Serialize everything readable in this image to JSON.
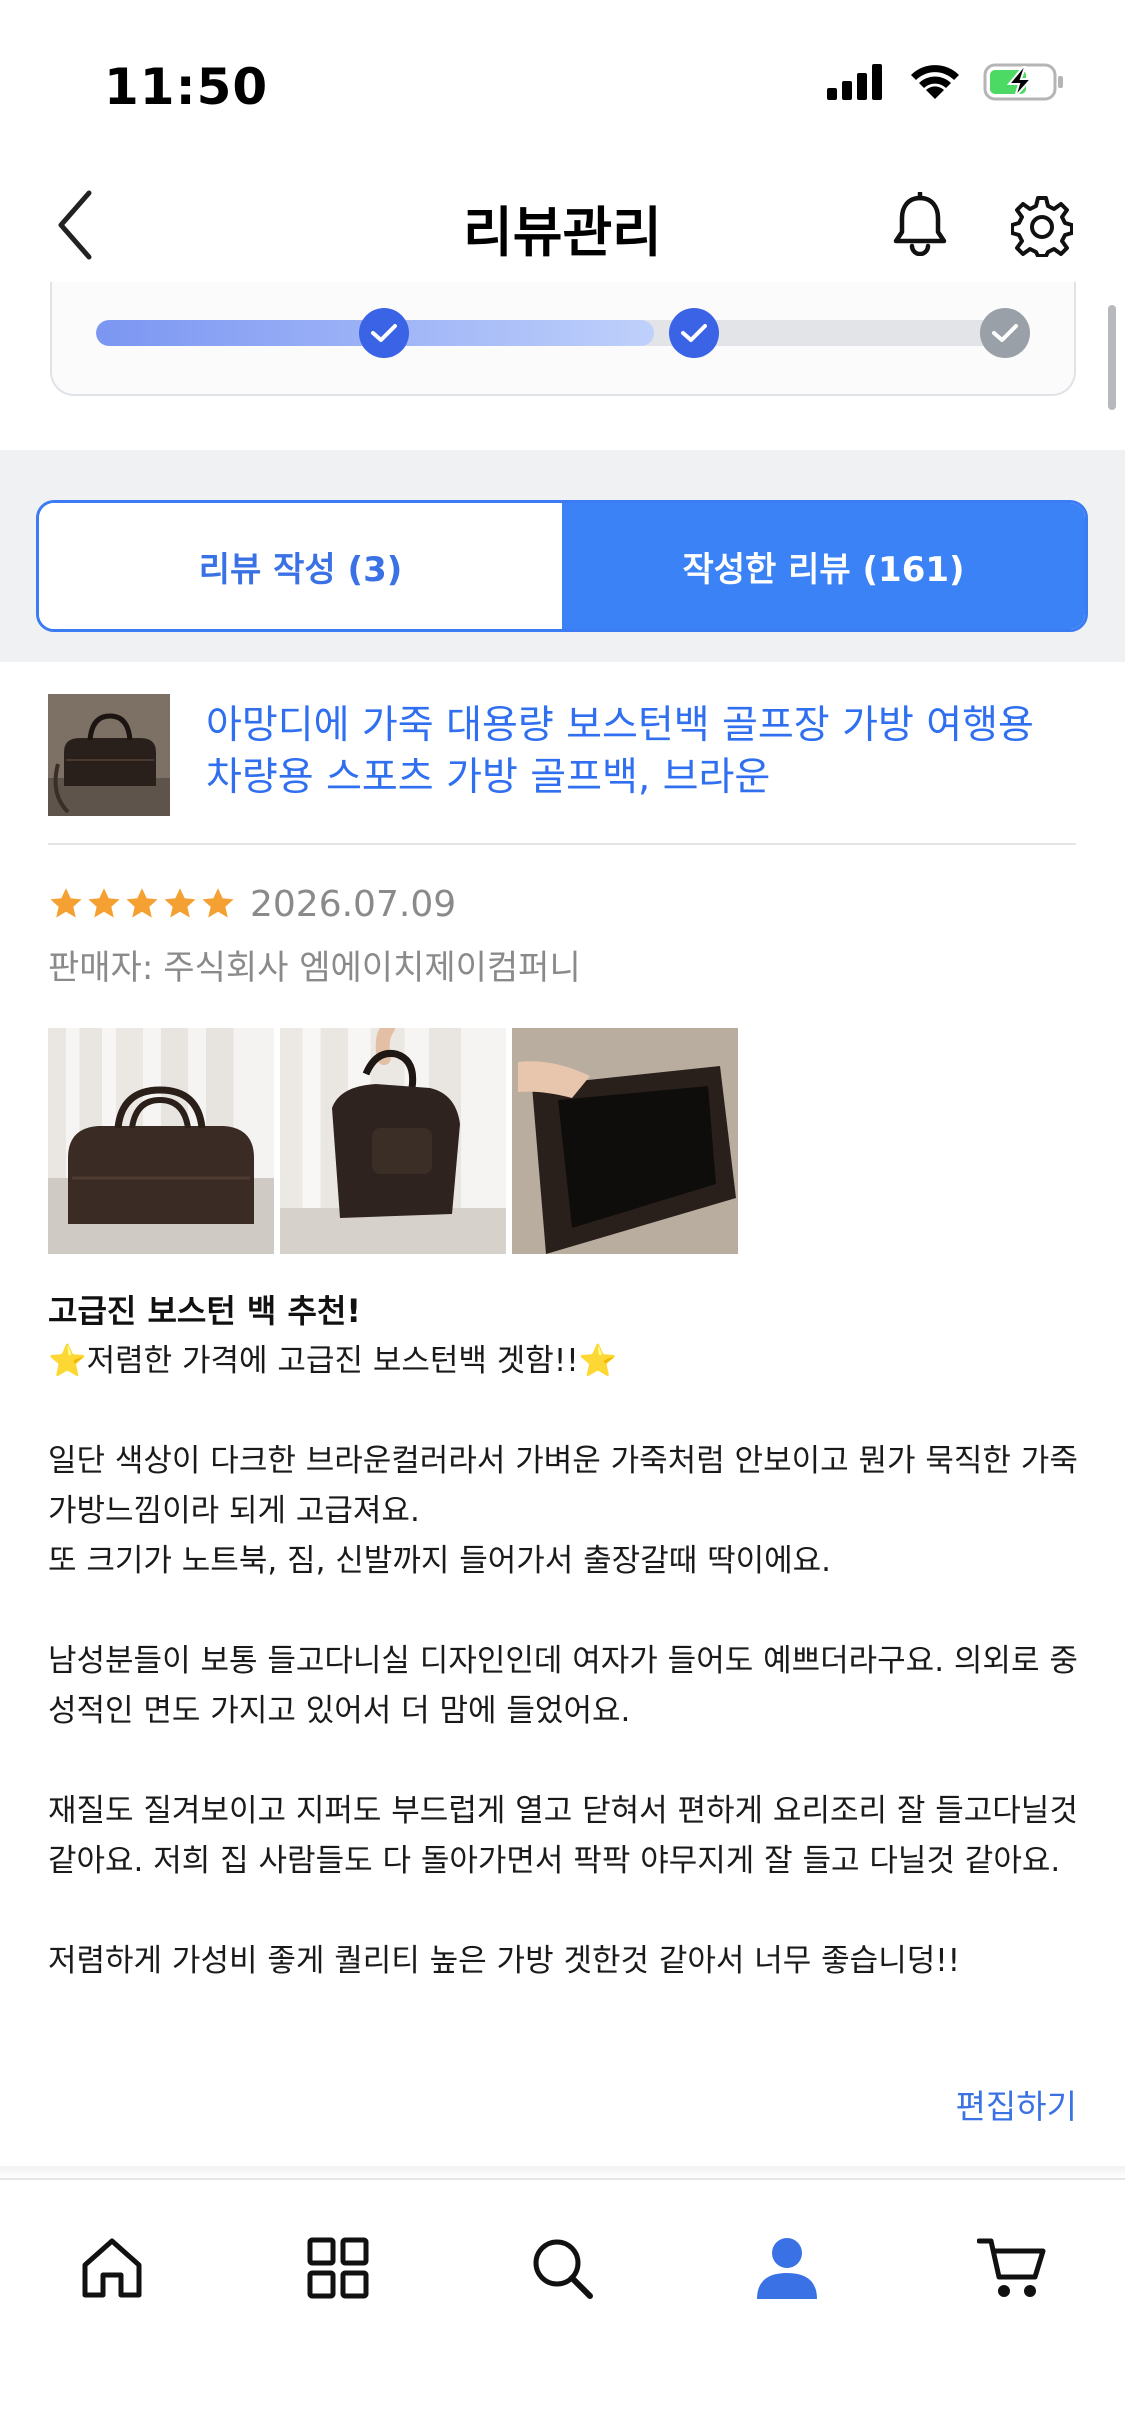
{
  "status_bar": {
    "time": "11:50",
    "icons": [
      "signal-icon",
      "wifi-icon",
      "battery-charging-icon"
    ],
    "battery_color": "#4cd964"
  },
  "header": {
    "title": "리뷰관리",
    "icons": [
      "back-chevron-icon",
      "bell-icon",
      "gear-icon"
    ]
  },
  "progress": {
    "level": 0.6,
    "steps": [
      {
        "state": "done"
      },
      {
        "state": "done"
      },
      {
        "state": "pending"
      }
    ],
    "active_color": "#3a63e6"
  },
  "tabs": [
    {
      "label": "리뷰 작성 (3)",
      "selected": false
    },
    {
      "label": "작성한 리뷰 (161)",
      "selected": true
    }
  ],
  "review": {
    "product_title": "아망디에 가죽 대용량 보스턴백 골프장 가방 여행용 차량용 스포츠 가방 골프백, 브라운",
    "rating": 5,
    "max_rating": 5,
    "date": "2026.07.09",
    "seller_label": "판매자:",
    "seller_name": "주식회사 엠에이치제이컴퍼니",
    "photo_count": 3,
    "heading": "고급진 보스턴 백 추천!",
    "paragraphs": [
      "⭐저렴한 가격에 고급진 보스턴백 겟함!!⭐",
      "일단 색상이 다크한 브라운컬러라서 가벼운 가죽처럼 안보이고 뭔가 묵직한 가죽 가방느낌이라 되게 고급져요.\n또 크기가 노트북, 짐, 신발까지 들어가서 출장갈때 딱이에요.",
      "남성분들이 보통 들고다니실 디자인인데 여자가 들어도 예쁘더라구요. 의외로 중성적인 면도 가지고 있어서 더 맘에 들었어요.",
      "재질도 질겨보이고 지퍼도 부드럽게 열고 닫혀서 편하게 요리조리 잘 들고다닐것 같아요. 저희 집 사람들도 다 돌아가면서 팍팍 야무지게 잘 들고 다닐것 같아요.",
      "저렴하게 가성비 좋게 퀄리티 높은 가방 겟한것 같아서 너무 좋습니덩!!"
    ],
    "edit_label": "편집하기",
    "star_color": "#f5a032"
  },
  "bottom_nav": {
    "items": [
      {
        "icon": "home-icon",
        "active": false
      },
      {
        "icon": "grid-icon",
        "active": false
      },
      {
        "icon": "search-icon",
        "active": false
      },
      {
        "icon": "profile-icon",
        "active": true
      },
      {
        "icon": "cart-icon",
        "active": false
      }
    ],
    "active_color": "#3a72e6"
  }
}
